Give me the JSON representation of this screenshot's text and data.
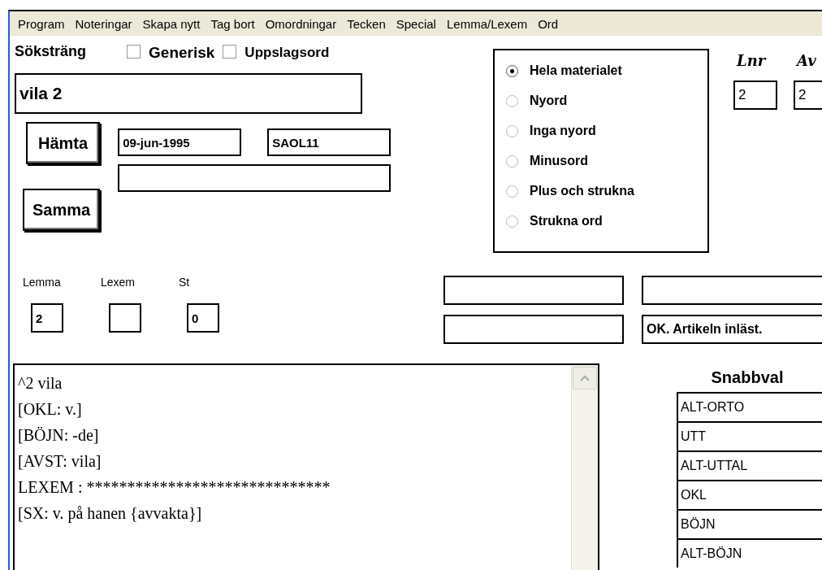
{
  "menu": [
    "Program",
    "Noteringar",
    "Skapa nytt",
    "Tag bort",
    "Omordningar",
    "Tecken",
    "Special",
    "Lemma/Lexem",
    "Ord"
  ],
  "search": {
    "label": "Söksträng",
    "value": "vila 2"
  },
  "options": [
    {
      "label": "Generisk",
      "checked": false,
      "kind": "large"
    },
    {
      "label": "Uppslagsord",
      "checked": false,
      "kind": "small"
    }
  ],
  "buttons": [
    "Hämta",
    "Samma"
  ],
  "date_field": "09-jun-1995",
  "source_field": "SAOL11",
  "scope": [
    {
      "label": "Hela materialet",
      "selected": true
    },
    {
      "label": "Nyord",
      "selected": false
    },
    {
      "label": "Inga nyord",
      "selected": false
    },
    {
      "label": "Minusord",
      "selected": false
    },
    {
      "label": "Plus och strukna",
      "selected": false
    },
    {
      "label": "Strukna ord",
      "selected": false
    }
  ],
  "counters": [
    {
      "label": "Lnr",
      "value": "2"
    },
    {
      "label": "Av",
      "value": "2"
    }
  ],
  "numbers": [
    {
      "label": "Lemma",
      "value": "2"
    },
    {
      "label": "Lexem"
    },
    {
      "label": "St",
      "value": "0"
    }
  ],
  "status_message": "OK. Artikeln inläst.",
  "article_lines": [
    "^2 vila",
    "[OKL: v.]",
    "[BÖJN: -de]",
    "[AVST: vila]",
    "LEXEM : ******************************",
    "[SX: v. på hanen {avvakta}]"
  ],
  "quick_choice": {
    "title": "Snabbval",
    "items": [
      "ALT-ORTO",
      "UTT",
      "ALT-UTTAL",
      "OKL",
      "BÖJN",
      "ALT-BÖJN"
    ]
  }
}
